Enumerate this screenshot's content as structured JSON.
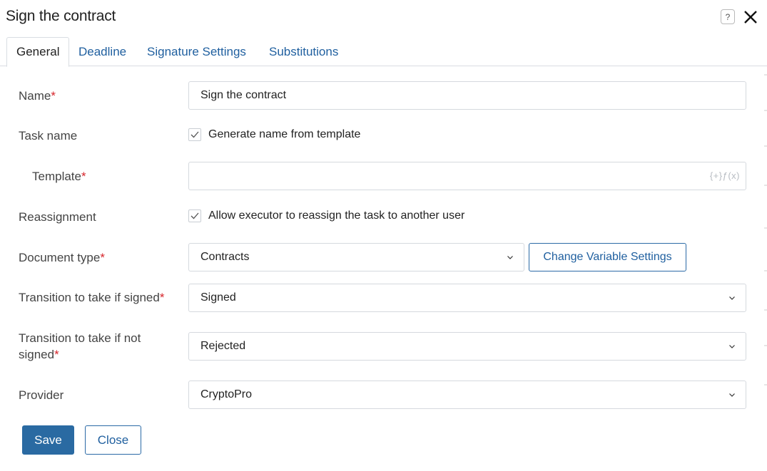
{
  "window": {
    "title": "Sign the contract",
    "help_label": "?"
  },
  "tabs": [
    {
      "label": "General",
      "active": true
    },
    {
      "label": "Deadline",
      "active": false
    },
    {
      "label": "Signature Settings",
      "active": false
    },
    {
      "label": "Substitutions",
      "active": false
    }
  ],
  "form": {
    "name": {
      "label": "Name",
      "required": "*",
      "value": "Sign the contract"
    },
    "task_name": {
      "label": "Task name",
      "checkbox_label": "Generate name from template",
      "checked": true
    },
    "template": {
      "label": "Template",
      "required": "*",
      "value": "",
      "fx_hint": "{+}ƒ(x)"
    },
    "reassignment": {
      "label": "Reassignment",
      "checkbox_label": "Allow executor to reassign the task to another user",
      "checked": true
    },
    "document_type": {
      "label": "Document type",
      "required": "*",
      "value": "Contracts",
      "button_label": "Change Variable Settings"
    },
    "transition_signed": {
      "label": "Transition to take if signed",
      "required": "*",
      "value": "Signed"
    },
    "transition_not_signed": {
      "label_line1": "Transition to take if not",
      "label_line2": "signed",
      "required": "*",
      "value": "Rejected"
    },
    "provider": {
      "label": "Provider",
      "value": "CryptoPro"
    }
  },
  "footer": {
    "save_label": "Save",
    "close_label": "Close"
  },
  "colors": {
    "accent": "#2a6aa2",
    "link": "#1f5f9f",
    "required": "#d6252b",
    "border": "#d5d9de"
  }
}
